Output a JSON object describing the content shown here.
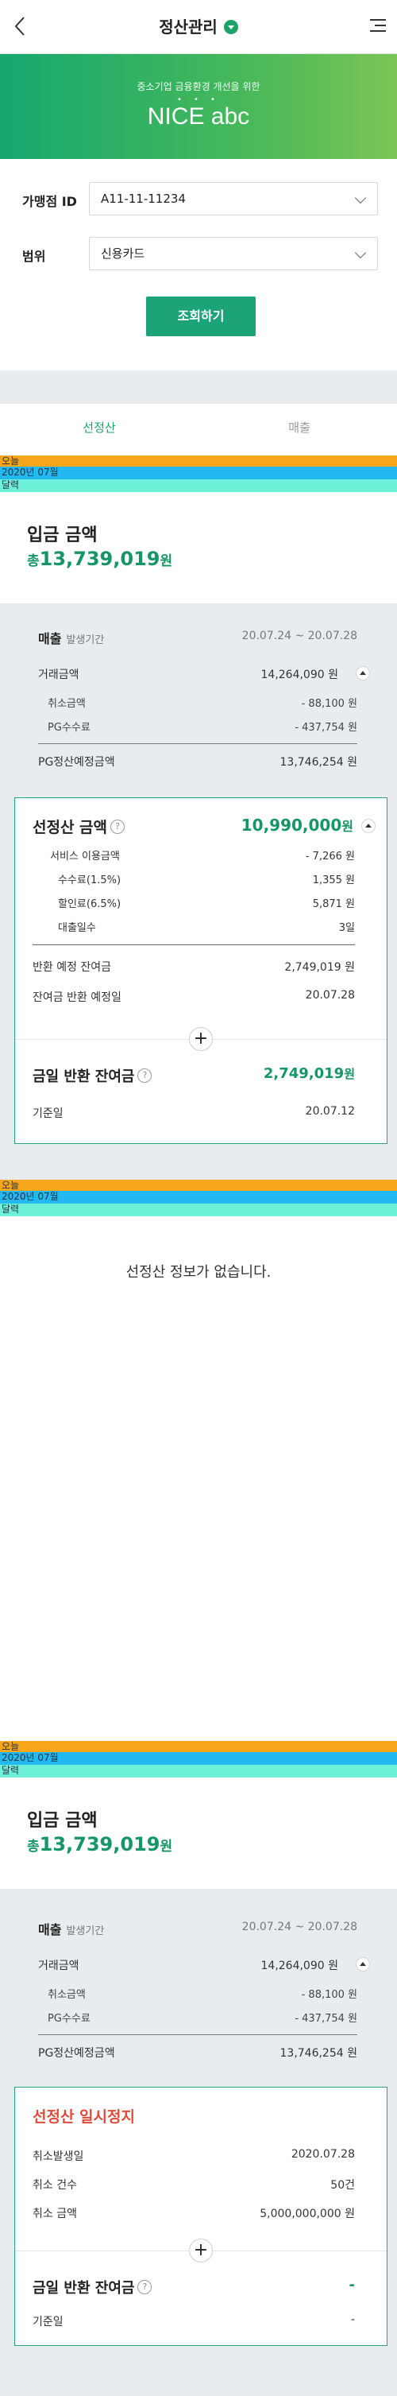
{
  "header": {
    "title": "정산관리",
    "back_icon": "chevron-left-icon",
    "menu_icon": "menu-icon",
    "dropdown_icon": "caret-down-icon"
  },
  "banner": {
    "subtitle": "중소기업 금융환경 개선을 위한",
    "dots": "• • •",
    "brand": "NICE abc"
  },
  "form": {
    "merchant_label": "가맹점 ID",
    "merchant_value": "A11-11-11234",
    "range_label": "범위",
    "range_value": "신용카드",
    "search_button": "조회하기"
  },
  "tabs": [
    {
      "label": "선정산"
    },
    {
      "label": "매출"
    }
  ],
  "datebar": {
    "today": "오늘",
    "month": "2020년 07월",
    "calendar": "달력"
  },
  "section1": {
    "deposit_title": "입금 금액",
    "deposit_prefix": "총",
    "deposit_amount": "13,739,019",
    "deposit_unit": "원",
    "sales_label": "매출",
    "sales_period_label": "발생기간",
    "sales_range": "20.07.24 ~ 20.07.28",
    "rows": [
      {
        "label": "거래금액",
        "value": "14,264,090 원"
      },
      {
        "label": "취소금액",
        "value": "- 88,100 원"
      },
      {
        "label": "PG수수료",
        "value": "- 437,754 원"
      }
    ],
    "pg_total_label": "PG정산예정금액",
    "pg_total_value": "13,746,254 원",
    "card": {
      "title": "선정산 금액",
      "amount": "10,990,000",
      "amount_unit": "원",
      "rows": [
        {
          "label": "서비스 이용금액",
          "value": "- 7,266 원"
        },
        {
          "label": "수수료(1.5%)",
          "value": "1,355 원"
        },
        {
          "label": "할인료(6.5%)",
          "value": "5,871 원"
        },
        {
          "label": "대출일수",
          "value": "3일"
        }
      ],
      "return_balance_label": "반환 예정 잔여금",
      "return_balance_value": "2,749,019 원",
      "return_date_label": "잔여금 반환 예정일",
      "return_date_value": "20.07.28",
      "today_return_label": "금일 반환 잔여금",
      "today_return_amount": "2,749,019",
      "today_return_unit": "원",
      "base_date_label": "기준일",
      "base_date_value": "20.07.12"
    }
  },
  "section2": {
    "empty_message": "선정산 정보가 없습니다."
  },
  "section3": {
    "deposit_title": "입금 금액",
    "deposit_prefix": "총",
    "deposit_amount": "13,739,019",
    "deposit_unit": "원",
    "sales_label": "매출",
    "sales_period_label": "발생기간",
    "sales_range": "20.07.24 ~ 20.07.28",
    "rows": [
      {
        "label": "거래금액",
        "value": "14,264,090 원"
      },
      {
        "label": "취소금액",
        "value": "- 88,100 원"
      },
      {
        "label": "PG수수료",
        "value": "- 437,754 원"
      }
    ],
    "pg_total_label": "PG정산예정금액",
    "pg_total_value": "13,746,254 원",
    "card": {
      "title": "선정산 일시정지",
      "rows": [
        {
          "label": "취소발생일",
          "value": "2020.07.28"
        },
        {
          "label": "취소 건수",
          "value": "50건"
        },
        {
          "label": "취소 금액",
          "value": "5,000,000,000 원"
        }
      ],
      "today_return_label": "금일 반환 잔여금",
      "today_return_value": "-",
      "base_date_label": "기준일",
      "base_date_value": "-"
    }
  },
  "colors": {
    "accent": "#1da36a",
    "amount": "#169565",
    "warning": "#e04a3b",
    "today_bar": "#f7a51a",
    "month_bar": "#23b8f0",
    "calendar_bar": "#6ef1d9"
  }
}
